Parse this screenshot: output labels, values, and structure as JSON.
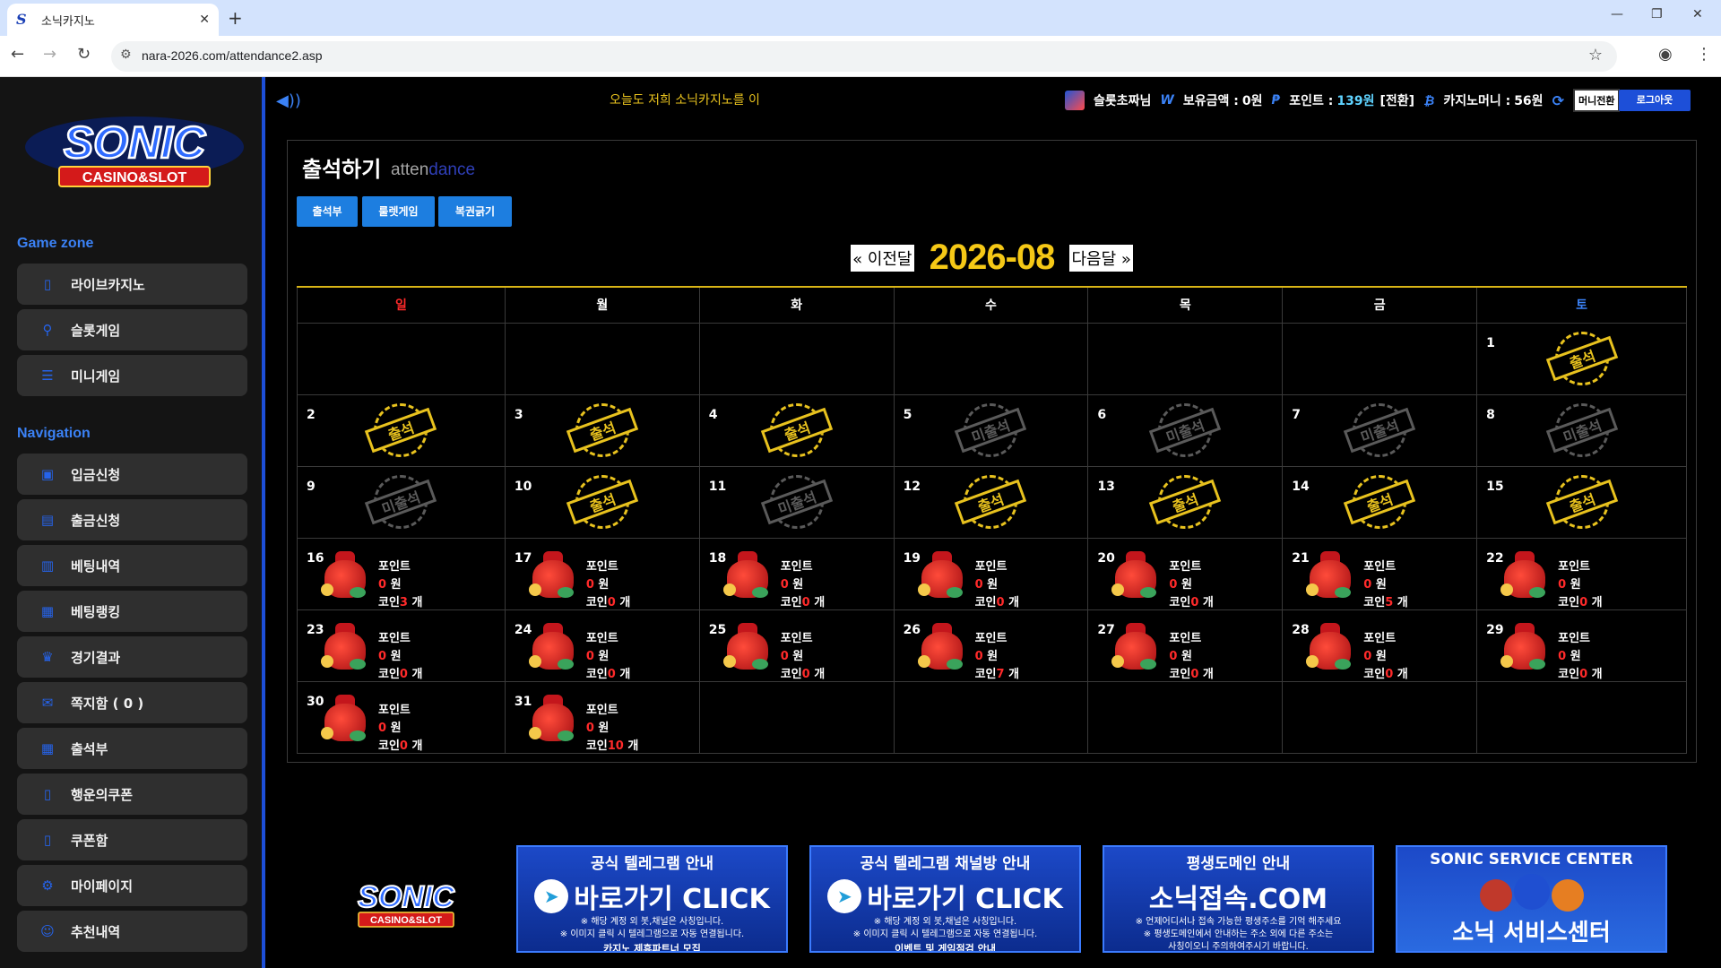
{
  "browser": {
    "tab_title": "소닉카지노",
    "favicon_letter": "S",
    "url": "nara-2026.com/attendance2.asp"
  },
  "sidebar": {
    "logo_alt": "SONIC CASINO & SLOT",
    "game_zone_title": "Game zone",
    "game_items": [
      {
        "label": "라이브카지노",
        "icon": "card-icon"
      },
      {
        "label": "슬롯게임",
        "icon": "lever-icon"
      },
      {
        "label": "미니게임",
        "icon": "list-icon"
      }
    ],
    "navigation_title": "Navigation",
    "nav_items": [
      {
        "label": "입금신청",
        "icon": "deposit-icon"
      },
      {
        "label": "출금신청",
        "icon": "withdraw-icon"
      },
      {
        "label": "베팅내역",
        "icon": "history-icon"
      },
      {
        "label": "베팅랭킹",
        "icon": "ranking-icon"
      },
      {
        "label": "경기결과",
        "icon": "trophy-icon"
      },
      {
        "label": "쪽지함 ( 0 )",
        "icon": "message-icon"
      },
      {
        "label": "출석부",
        "icon": "calendar-icon"
      },
      {
        "label": "행운의쿠폰",
        "icon": "coupon-icon"
      },
      {
        "label": "쿠폰함",
        "icon": "coupon-box-icon"
      },
      {
        "label": "마이페이지",
        "icon": "gear-icon"
      },
      {
        "label": "추천내역",
        "icon": "user-icon"
      }
    ]
  },
  "topbar": {
    "marquee": "오늘도 저희 소닉카지노를 이",
    "username": "슬롯초짜님",
    "balance_label": "보유금액 :",
    "balance_value": "0원",
    "point_label": "포인트 :",
    "point_value": "139원",
    "point_convert": "[전환]",
    "casino_label": "카지노머니 :",
    "casino_value": "56원",
    "money_convert_btn": "머니전환",
    "logout_btn": "로그아웃"
  },
  "attendance": {
    "title": "출석하기",
    "subtitle_a": "atten",
    "subtitle_b": "dance",
    "tabs": [
      "출석부",
      "룰렛게임",
      "복권긁기"
    ],
    "prev_label": "« 이전달",
    "next_label": "다음달 »",
    "month": "2026-08",
    "weekdays": [
      "일",
      "월",
      "화",
      "수",
      "목",
      "금",
      "토"
    ],
    "stamp_yes": "출석",
    "stamp_no": "미출석",
    "reward_point_label": "포인트",
    "reward_won_unit": "원",
    "reward_coin_label": "코인",
    "reward_coin_unit": "개",
    "weeks": [
      [
        null,
        null,
        null,
        null,
        null,
        null,
        {
          "day": "1",
          "type": "yes"
        }
      ],
      [
        {
          "day": "2",
          "type": "yes"
        },
        {
          "day": "3",
          "type": "yes"
        },
        {
          "day": "4",
          "type": "yes"
        },
        {
          "day": "5",
          "type": "no"
        },
        {
          "day": "6",
          "type": "no"
        },
        {
          "day": "7",
          "type": "no"
        },
        {
          "day": "8",
          "type": "no"
        }
      ],
      [
        {
          "day": "9",
          "type": "no"
        },
        {
          "day": "10",
          "type": "yes"
        },
        {
          "day": "11",
          "type": "no"
        },
        {
          "day": "12",
          "type": "yes"
        },
        {
          "day": "13",
          "type": "yes"
        },
        {
          "day": "14",
          "type": "yes"
        },
        {
          "day": "15",
          "type": "yes"
        }
      ],
      [
        {
          "day": "16",
          "type": "reward",
          "point": "0",
          "coin": "3"
        },
        {
          "day": "17",
          "type": "reward",
          "point": "0",
          "coin": "0"
        },
        {
          "day": "18",
          "type": "reward",
          "point": "0",
          "coin": "0"
        },
        {
          "day": "19",
          "type": "reward",
          "point": "0",
          "coin": "0"
        },
        {
          "day": "20",
          "type": "reward",
          "point": "0",
          "coin": "0"
        },
        {
          "day": "21",
          "type": "reward",
          "point": "0",
          "coin": "5"
        },
        {
          "day": "22",
          "type": "reward",
          "point": "0",
          "coin": "0"
        }
      ],
      [
        {
          "day": "23",
          "type": "reward",
          "point": "0",
          "coin": "0"
        },
        {
          "day": "24",
          "type": "reward",
          "point": "0",
          "coin": "0"
        },
        {
          "day": "25",
          "type": "reward",
          "point": "0",
          "coin": "0"
        },
        {
          "day": "26",
          "type": "reward",
          "point": "0",
          "coin": "7"
        },
        {
          "day": "27",
          "type": "reward",
          "point": "0",
          "coin": "0"
        },
        {
          "day": "28",
          "type": "reward",
          "point": "0",
          "coin": "0"
        },
        {
          "day": "29",
          "type": "reward",
          "point": "0",
          "coin": "0"
        }
      ],
      [
        {
          "day": "30",
          "type": "reward",
          "point": "0",
          "coin": "0"
        },
        {
          "day": "31",
          "type": "reward",
          "point": "0",
          "coin": "10"
        },
        null,
        null,
        null,
        null,
        null
      ]
    ]
  },
  "footer": {
    "logo_alt": "SONIC CASINO & SLOT",
    "banners": [
      {
        "title": "공식 텔레그램 안내",
        "main": "바로가기 CLICK",
        "note1": "※ 해당 계정 외 봇,채널은 사칭입니다.",
        "note2": "※ 이미지 클릭 시 텔레그램으로 자동 연결됩니다.",
        "bottom": "카지노 제휴파트너 모집"
      },
      {
        "title": "공식 텔레그램 채널방 안내",
        "main": "바로가기 CLICK",
        "note1": "※ 해당 계정 외 봇,채널은 사칭입니다.",
        "note2": "※ 이미지 클릭 시 텔레그램으로 자동 연결됩니다.",
        "bottom": "이벤트 및 게임점검 안내"
      },
      {
        "title": "평생도메인 안내",
        "main": "소닉접속.COM",
        "note1": "※ 언제어디서나 접속 가능한 평생주소를 기억 해주세요",
        "note2": "※ 평생도메인에서 안내하는 주소 외에 다른 주소는",
        "bottom": "사칭이오니 주의하여주시기 바랍니다."
      },
      {
        "title": "SONIC SERVICE CENTER",
        "main": "소닉 서비스센터"
      }
    ]
  },
  "colors": {
    "accent": "#1d4fd8",
    "stamp_yes": "#e8c21e",
    "stamp_no": "#5a5a5a",
    "month_title": "#f5c816",
    "sunday": "#ff2a2a",
    "saturday": "#3b82f6"
  }
}
